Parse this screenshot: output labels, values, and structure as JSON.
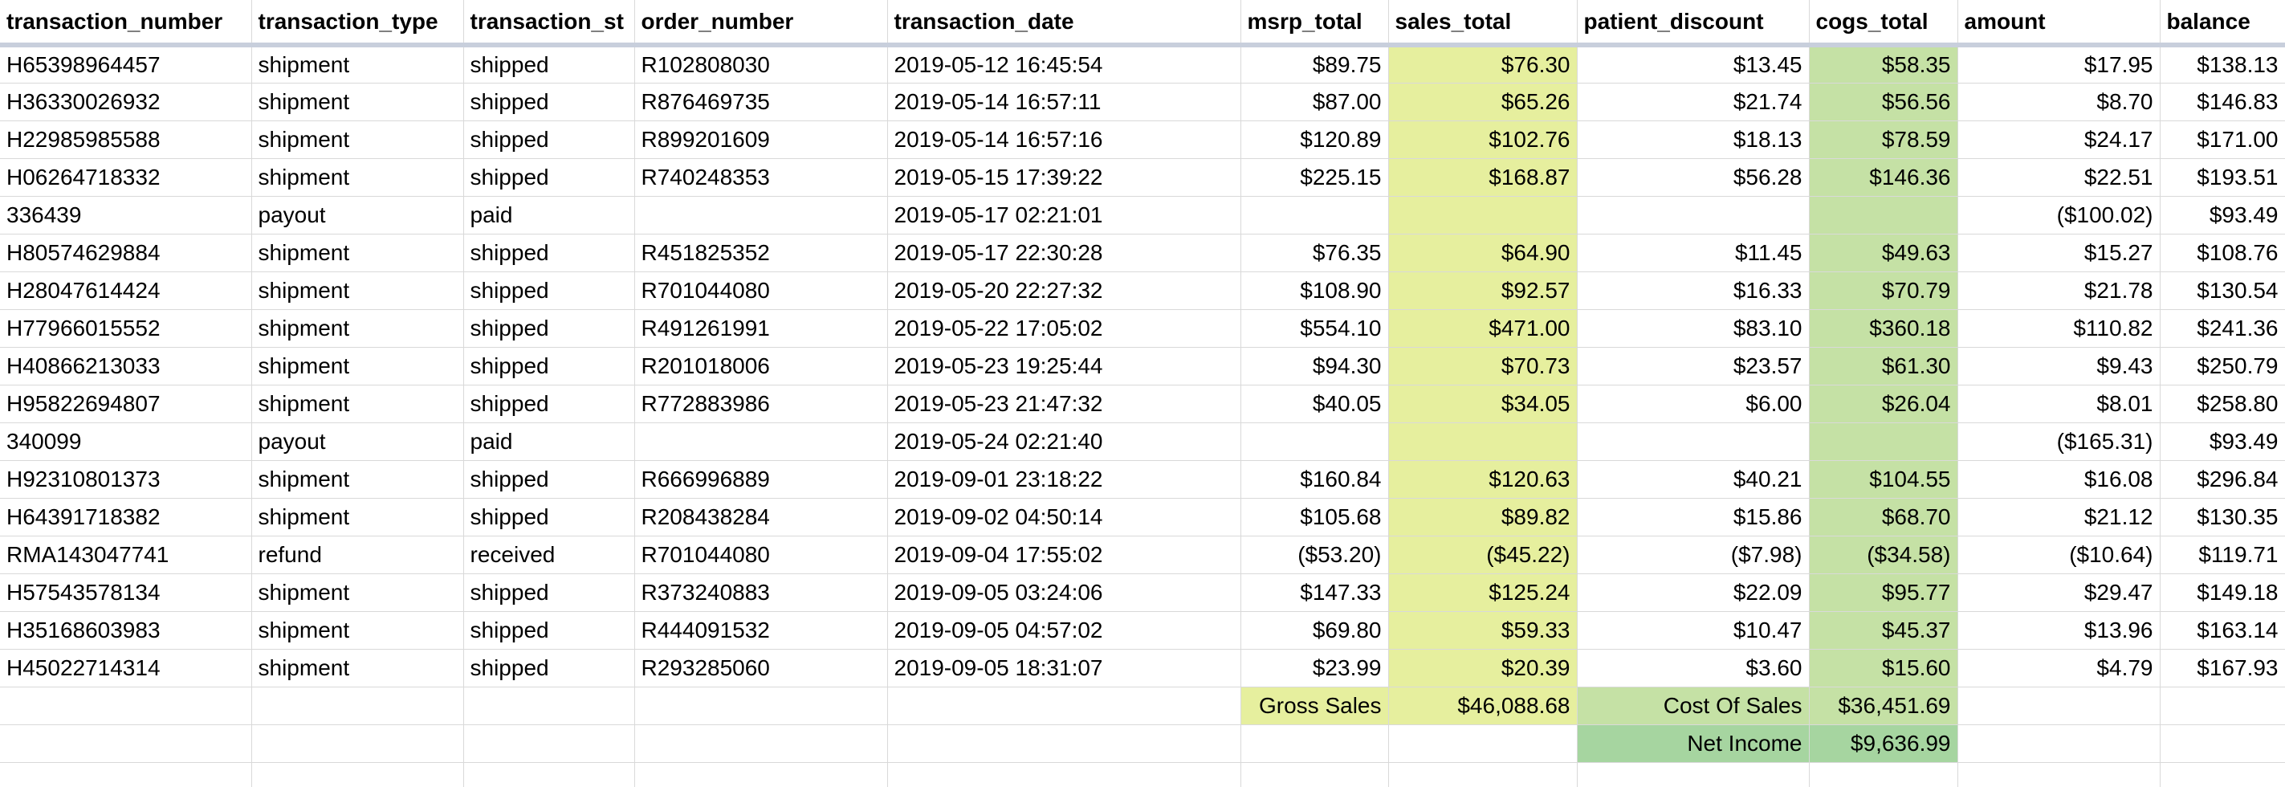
{
  "columns": [
    {
      "key": "transaction_number",
      "label": "transaction_number",
      "align": "left"
    },
    {
      "key": "transaction_type",
      "label": "transaction_type",
      "align": "left"
    },
    {
      "key": "transaction_status",
      "label": "transaction_st",
      "align": "left"
    },
    {
      "key": "order_number",
      "label": "order_number",
      "align": "left"
    },
    {
      "key": "transaction_date",
      "label": "transaction_date",
      "align": "left"
    },
    {
      "key": "msrp_total",
      "label": "msrp_total",
      "align": "right"
    },
    {
      "key": "sales_total",
      "label": "sales_total",
      "align": "right"
    },
    {
      "key": "patient_discount",
      "label": "patient_discount",
      "align": "right"
    },
    {
      "key": "cogs_total",
      "label": "cogs_total",
      "align": "right"
    },
    {
      "key": "amount",
      "label": "amount",
      "align": "right"
    },
    {
      "key": "balance",
      "label": "balance",
      "align": "right"
    }
  ],
  "rows": [
    [
      "H65398964457",
      "shipment",
      "shipped",
      "R102808030",
      "2019-05-12 16:45:54",
      "$89.75",
      "$76.30",
      "$13.45",
      "$58.35",
      "$17.95",
      "$138.13"
    ],
    [
      "H36330026932",
      "shipment",
      "shipped",
      "R876469735",
      "2019-05-14 16:57:11",
      "$87.00",
      "$65.26",
      "$21.74",
      "$56.56",
      "$8.70",
      "$146.83"
    ],
    [
      "H22985985588",
      "shipment",
      "shipped",
      "R899201609",
      "2019-05-14 16:57:16",
      "$120.89",
      "$102.76",
      "$18.13",
      "$78.59",
      "$24.17",
      "$171.00"
    ],
    [
      "H06264718332",
      "shipment",
      "shipped",
      "R740248353",
      "2019-05-15 17:39:22",
      "$225.15",
      "$168.87",
      "$56.28",
      "$146.36",
      "$22.51",
      "$193.51"
    ],
    [
      "336439",
      "payout",
      "paid",
      "",
      "2019-05-17 02:21:01",
      "",
      "",
      "",
      "",
      "($100.02)",
      "$93.49"
    ],
    [
      "H80574629884",
      "shipment",
      "shipped",
      "R451825352",
      "2019-05-17 22:30:28",
      "$76.35",
      "$64.90",
      "$11.45",
      "$49.63",
      "$15.27",
      "$108.76"
    ],
    [
      "H28047614424",
      "shipment",
      "shipped",
      "R701044080",
      "2019-05-20 22:27:32",
      "$108.90",
      "$92.57",
      "$16.33",
      "$70.79",
      "$21.78",
      "$130.54"
    ],
    [
      "H77966015552",
      "shipment",
      "shipped",
      "R491261991",
      "2019-05-22 17:05:02",
      "$554.10",
      "$471.00",
      "$83.10",
      "$360.18",
      "$110.82",
      "$241.36"
    ],
    [
      "H40866213033",
      "shipment",
      "shipped",
      "R201018006",
      "2019-05-23 19:25:44",
      "$94.30",
      "$70.73",
      "$23.57",
      "$61.30",
      "$9.43",
      "$250.79"
    ],
    [
      "H95822694807",
      "shipment",
      "shipped",
      "R772883986",
      "2019-05-23 21:47:32",
      "$40.05",
      "$34.05",
      "$6.00",
      "$26.04",
      "$8.01",
      "$258.80"
    ],
    [
      "340099",
      "payout",
      "paid",
      "",
      "2019-05-24 02:21:40",
      "",
      "",
      "",
      "",
      "($165.31)",
      "$93.49"
    ],
    [
      "H92310801373",
      "shipment",
      "shipped",
      "R666996889",
      "2019-09-01 23:18:22",
      "$160.84",
      "$120.63",
      "$40.21",
      "$104.55",
      "$16.08",
      "$296.84"
    ],
    [
      "H64391718382",
      "shipment",
      "shipped",
      "R208438284",
      "2019-09-02 04:50:14",
      "$105.68",
      "$89.82",
      "$15.86",
      "$68.70",
      "$21.12",
      "$130.35"
    ],
    [
      "RMA143047741",
      "refund",
      "received",
      "R701044080",
      "2019-09-04 17:55:02",
      "($53.20)",
      "($45.22)",
      "($7.98)",
      "($34.58)",
      "($10.64)",
      "$119.71"
    ],
    [
      "H57543578134",
      "shipment",
      "shipped",
      "R373240883",
      "2019-09-05 03:24:06",
      "$147.33",
      "$125.24",
      "$22.09",
      "$95.77",
      "$29.47",
      "$149.18"
    ],
    [
      "H35168603983",
      "shipment",
      "shipped",
      "R444091532",
      "2019-09-05 04:57:02",
      "$69.80",
      "$59.33",
      "$10.47",
      "$45.37",
      "$13.96",
      "$163.14"
    ],
    [
      "H45022714314",
      "shipment",
      "shipped",
      "R293285060",
      "2019-09-05 18:31:07",
      "$23.99",
      "$20.39",
      "$3.60",
      "$15.60",
      "$4.79",
      "$167.93"
    ]
  ],
  "summary": {
    "gross_sales_label": "Gross Sales",
    "gross_sales_value": "$46,088.68",
    "cost_of_sales_label": "Cost Of Sales",
    "cost_of_sales_value": "$36,451.69",
    "net_income_label": "Net Income",
    "net_income_value": "$9,636.99"
  },
  "colors": {
    "sales_highlight": "#e6ef9e",
    "cogs_highlight": "#c5e1a5",
    "net_income_highlight": "#a6d5a0",
    "negative_text": "#ff0000",
    "header_border": "#c8cfdc"
  }
}
